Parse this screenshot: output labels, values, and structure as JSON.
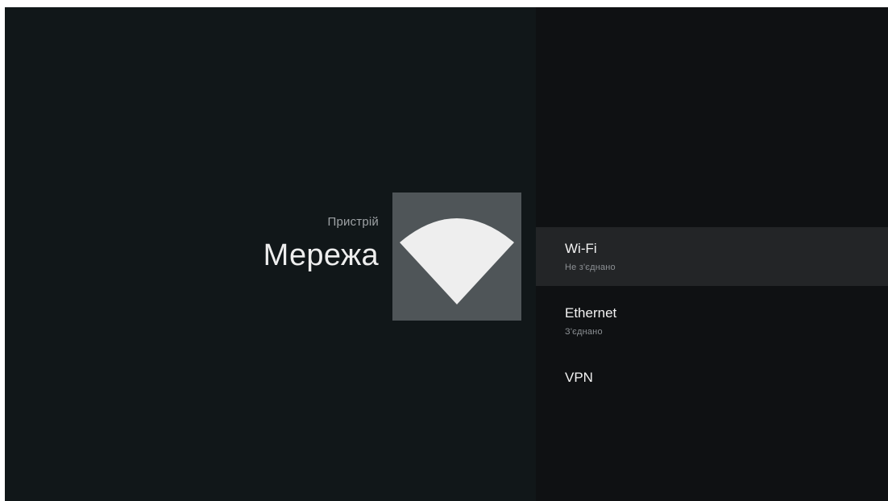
{
  "header": {
    "breadcrumb": "Пристрій",
    "title": "Мережа"
  },
  "icon": {
    "name": "wifi-icon"
  },
  "menu": {
    "items": [
      {
        "label": "Wi-Fi",
        "status": "Не з'єднано",
        "selected": true
      },
      {
        "label": "Ethernet",
        "status": "З'єднано",
        "selected": false
      },
      {
        "label": "VPN",
        "status": "",
        "selected": false
      }
    ]
  },
  "colors": {
    "background": "#111719",
    "panel": "#0f1113",
    "selected_row": "#232527",
    "icon_tile": "#4f5558",
    "icon_glyph": "#eeeeee"
  }
}
